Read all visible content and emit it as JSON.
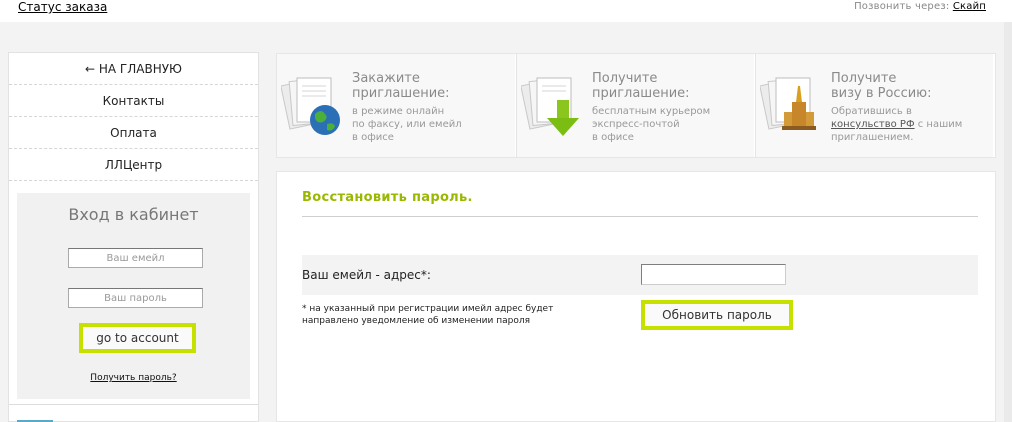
{
  "header": {
    "status_link": "Статус заказа",
    "call_label": "Позвонить через:",
    "skype_link": "Скайп"
  },
  "sidebar": {
    "nav": [
      {
        "label": "← НА ГЛАВНУЮ"
      },
      {
        "label": "Контакты"
      },
      {
        "label": "Оплата"
      },
      {
        "label": "ЛЛЦентр"
      }
    ],
    "login": {
      "title": "Вход в кабинет",
      "email_placeholder": "Ваш емейл",
      "password_placeholder": "Ваш пароль",
      "button": "go to account",
      "forgot_link": "Получить пароль?"
    }
  },
  "promo": [
    {
      "title_1": "Закажите",
      "title_2": "приглашение:",
      "lines": [
        "в режиме онлайн",
        "по факсу, или емейл",
        "в офисе"
      ],
      "icon": "globe-document-icon"
    },
    {
      "title_1": "Получите",
      "title_2": "приглашение:",
      "lines": [
        "бесплатным курьером",
        "экспресс-почтой",
        "в офисе"
      ],
      "icon": "download-document-icon"
    },
    {
      "title_1": "Получите",
      "title_2": "визу в Россию:",
      "line_1": "Обратившись в",
      "line_2_link": "консульство РФ",
      "line_2_rest": " с нашим",
      "line_3": "приглашением.",
      "icon": "building-document-icon"
    }
  ],
  "main": {
    "title": "Восстановить пароль.",
    "email_label": "Ваш емейл - адрес*:",
    "email_value": "",
    "note_1": "* на указанный при регистрации имейл адрес будет",
    "note_2": "направлено уведомление об изменении пароля",
    "button": "Обновить пароль"
  },
  "colors": {
    "accent": "#c6e000",
    "title_green": "#9ab800"
  }
}
